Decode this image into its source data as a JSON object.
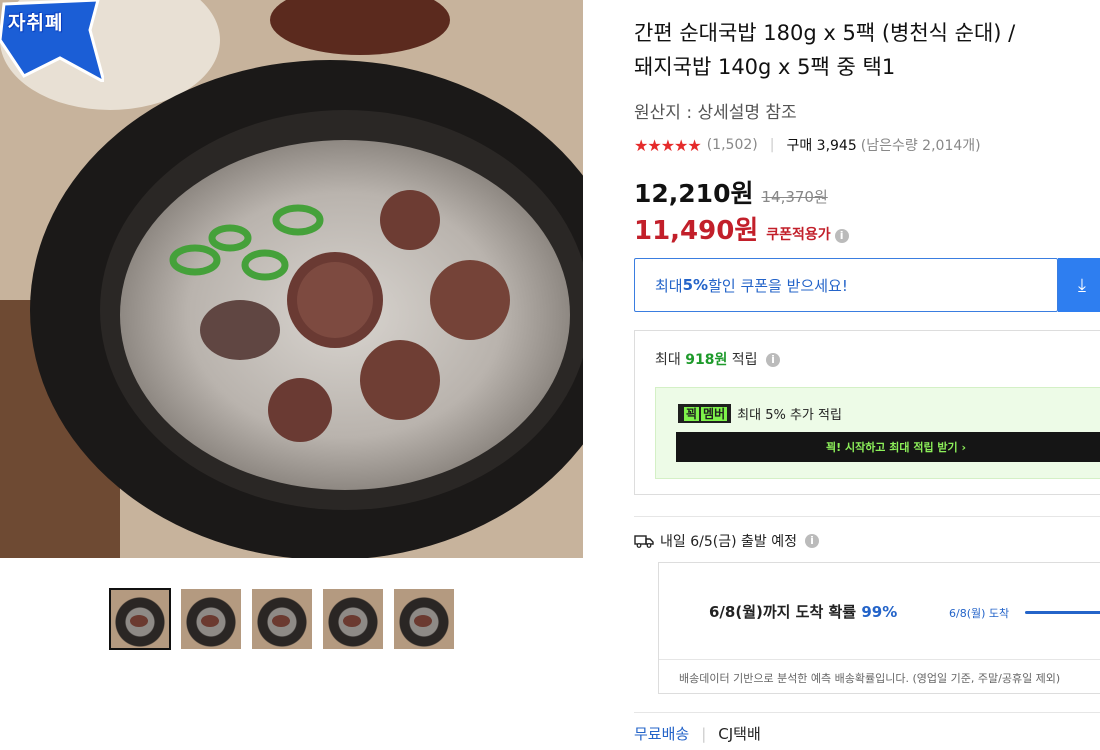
{
  "badge": {
    "text": "자취폐"
  },
  "product": {
    "title": "간편 순대국밥 180g x 5팩 (병천식 순대) /\n돼지국밥 140g x 5팩 중 택1",
    "origin": "원산지 : 상세설명 참조",
    "rating_stars": "★★★★★",
    "rating_value": 4.5,
    "review_count": "(1,502)",
    "sold": "구매 3,945",
    "remaining": "(남은수량 2,014개)",
    "sale_price": "12,210원",
    "original_price": "14,370원",
    "coupon_price": "11,490원",
    "coupon_label": "쿠폰적용가"
  },
  "coupon_banner": {
    "prefix": "최대 ",
    "percent": "5%",
    "suffix": " 할인 쿠폰을 받으세요!",
    "icon": "download-icon"
  },
  "reward": {
    "prefix": "최대 ",
    "amount": "918원",
    "suffix": " 적립",
    "member_logo": "꾁",
    "member_logo_tag": "멤버",
    "member_text": "최대 5% 추가 적립",
    "member_cta": "꾁! 시작하고 최대 적립 받기 ›"
  },
  "shipping": {
    "departure": "내일 6/5(금) 출발 예정",
    "arrival_prefix": "6/8(월)까지 도착 확률 ",
    "arrival_percent": "99%",
    "arrival_marker": "6/8(월) 도착",
    "note": "배송데이터 기반으로 분석한 예측 배송확률입니다. (영업일 기준, 주말/공휴일 제외)",
    "free_shipping": "무료배송",
    "courier": "CJ택배"
  },
  "thumbnails": [
    "thumb-1",
    "thumb-2",
    "thumb-3",
    "thumb-4",
    "thumb-5"
  ],
  "colors": {
    "accent_blue": "#2464c9",
    "price_red": "#c21f2a",
    "reward_green": "#1e9a2b"
  }
}
